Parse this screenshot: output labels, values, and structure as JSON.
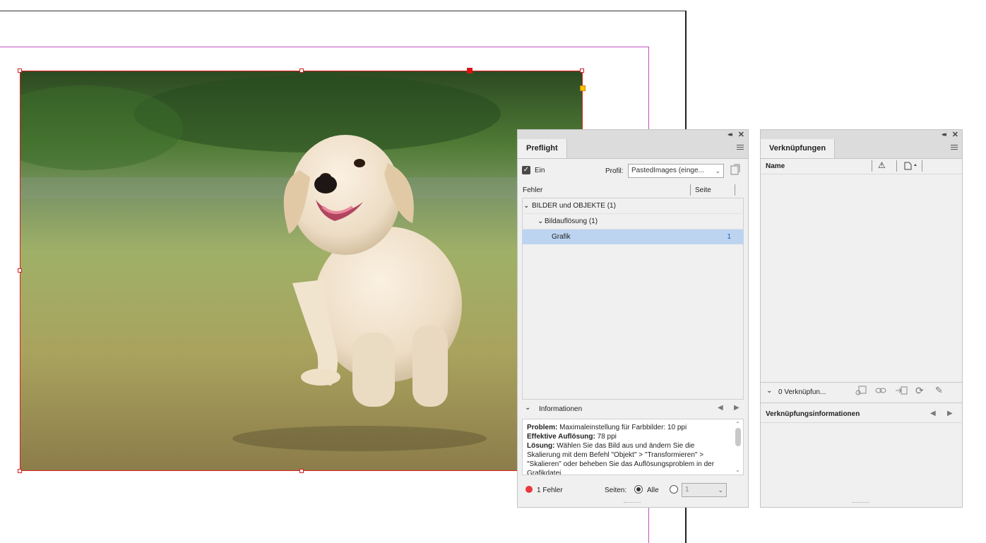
{
  "preflight": {
    "tab": "Preflight",
    "on_label": "Ein",
    "profile_label": "Profil:",
    "profile_value": "PastedImages (einge...",
    "col_errors": "Fehler",
    "col_page": "Seite",
    "tree": [
      {
        "label": "BILDER und OBJEKTE (1)",
        "page": ""
      },
      {
        "label": "Bildauflösung (1)",
        "page": ""
      },
      {
        "label": "Grafik",
        "page": "1"
      }
    ],
    "info_header": "Informationen",
    "info": {
      "problem_label": "Problem:",
      "problem_text": "Maximaleinstellung für Farbbilder: 10 ppi",
      "effective_label": "Effektive Auflösung:",
      "effective_text": "78 ppi",
      "solution_label": "Lösung:",
      "solution_text": "Wählen Sie das Bild aus und ändern Sie die Skalierung mit dem Befehl \"Objekt\" > \"Transformieren\" > \"Skalieren\" oder beheben Sie das Auflösungsproblem in der Grafikdatei."
    },
    "status": {
      "errors": "1 Fehler",
      "pages_label": "Seiten:",
      "all_label": "Alle",
      "page_value": "1"
    },
    "colors": {
      "error_dot": "#e8383d",
      "selected_row": "#bcd4f0",
      "page_number": "#2060c0"
    }
  },
  "links": {
    "tab": "Verknüpfungen",
    "col_name": "Name",
    "count": "0 Verknüpfun...",
    "info_header": "Verknüpfungsinformationen"
  }
}
